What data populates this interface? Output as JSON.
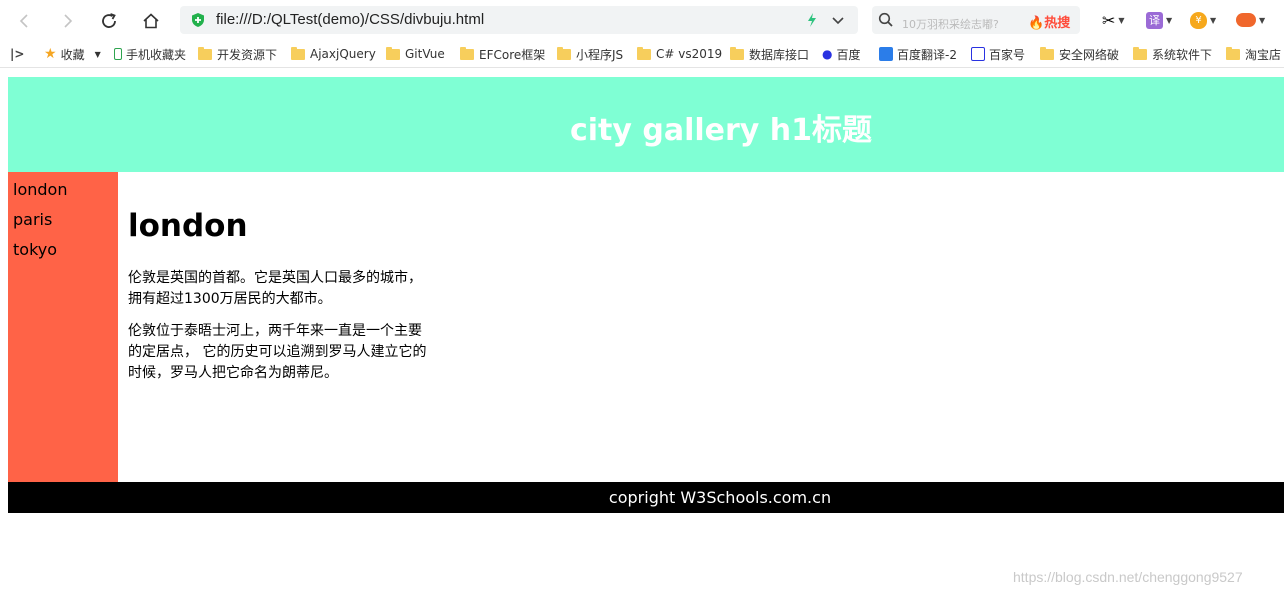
{
  "browser": {
    "address": "file:///D:/QLTest(demo)/CSS/divbuju.html",
    "search_placeholder": "10万羽积采绘志嘟?",
    "hot_label": "热搜",
    "ext_translate": "译",
    "ext_yen": "¥"
  },
  "bookmarks": [
    {
      "label": "收藏"
    },
    {
      "label": "手机收藏夹"
    },
    {
      "label": "开发资源下"
    },
    {
      "label": "AjaxjQuery"
    },
    {
      "label": "GitVue"
    },
    {
      "label": "EFCore框架"
    },
    {
      "label": "小程序JS"
    },
    {
      "label": "C# vs2019"
    },
    {
      "label": "数据库接口"
    },
    {
      "label": "百度"
    },
    {
      "label": "百度翻译-2"
    },
    {
      "label": "百家号"
    },
    {
      "label": "安全网络破"
    },
    {
      "label": "系统软件下"
    },
    {
      "label": "淘宝店"
    }
  ],
  "page": {
    "header_title": "city gallery h1标题",
    "nav": [
      "london",
      "paris",
      "tokyo"
    ],
    "section_title": "london",
    "para1_line1": "伦敦是英国的首都。它是英国人口最多的城市，",
    "para1_line2": "拥有超过1300万居民的大都市。",
    "para2_line1": "伦敦位于泰晤士河上，两千年来一直是一个主要",
    "para2_line2": "的定居点， 它的历史可以追溯到罗马人建立它的",
    "para2_line3": "时候，罗马人把它命名为朗蒂尼。",
    "footer": "copright W3Schools.com.cn"
  },
  "watermark": "https://blog.csdn.net/chenggong9527",
  "colors": {
    "header_bg": "#7fffd4",
    "nav_bg": "#ff6347",
    "footer_bg": "#000000"
  }
}
